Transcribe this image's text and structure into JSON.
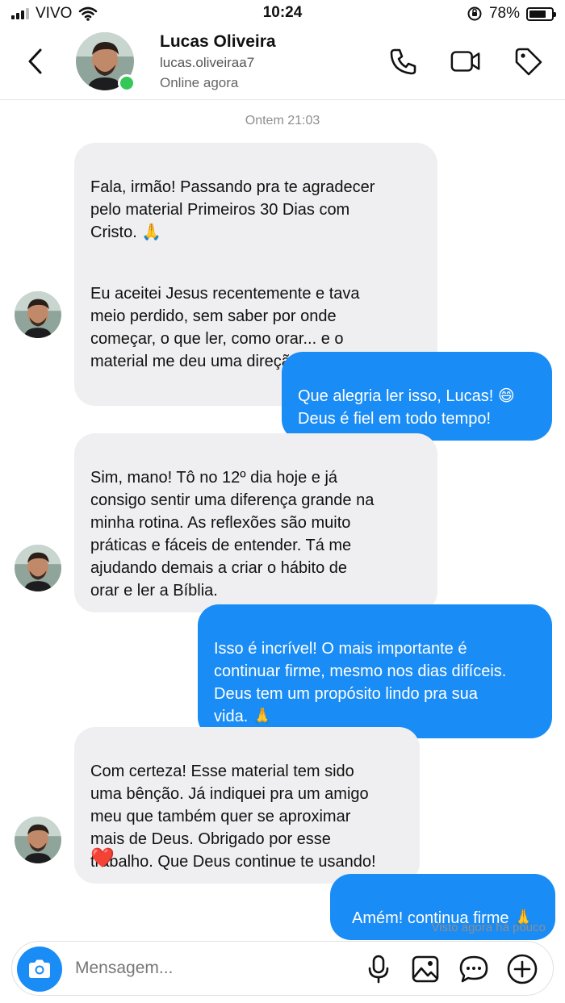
{
  "status_bar": {
    "carrier": "VIVO",
    "time": "10:24",
    "battery": "78%",
    "battery_level": 0.78
  },
  "header": {
    "name": "Lucas Oliveira",
    "username": "lucas.oliveiraa7",
    "status": "Online agora",
    "icons": [
      "back-chevron-icon",
      "phone-icon",
      "video-camera-icon",
      "tag-icon"
    ]
  },
  "chat": {
    "timestamp": "Ontem 21:03",
    "messages": [
      {
        "from": "contact",
        "paragraphs": [
          "Fala, irmão! Passando pra te agradecer\npelo material Primeiros 30 Dias com\nCristo. 🙏",
          "Eu aceitei Jesus recentemente e tava\nmeio perdido, sem saber por onde\ncomeçar, o que ler, como orar... e o\nmaterial me deu uma direção clara."
        ]
      },
      {
        "from": "me",
        "text": "Que alegria ler isso, Lucas! 😄\nDeus é fiel em todo tempo!"
      },
      {
        "from": "contact",
        "text": "Sim, mano! Tô no 12º dia hoje e já\nconsigo sentir uma diferença grande na\nminha rotina. As reflexões são muito\npráticas e fáceis de entender. Tá me\najudando demais a criar o hábito de\norar e ler a Bíblia."
      },
      {
        "from": "me",
        "text": "Isso é incrível! O mais importante é\ncontinuar firme, mesmo nos dias difíceis.\nDeus tem um propósito lindo pra sua\nvida. 🙏"
      },
      {
        "from": "contact",
        "text": "Com certeza! Esse material tem sido\numa bênção. Já indiquei pra um amigo\nmeu que também quer se aproximar\nmais de Deus. Obrigado por esse\ntrabalho. Que Deus continue te usando!",
        "reaction": "❤️"
      },
      {
        "from": "me",
        "text": "Amém! continua firme 🙏"
      }
    ],
    "seen": "Visto agora há pouco"
  },
  "composer": {
    "placeholder": "Mensagem...",
    "icons": [
      "camera-icon",
      "microphone-icon",
      "image-icon",
      "sticker-chat-icon",
      "plus-icon"
    ]
  },
  "colors": {
    "accent": "#1a8cf5",
    "incoming_bubble": "#efeff1",
    "online": "#36c759"
  }
}
